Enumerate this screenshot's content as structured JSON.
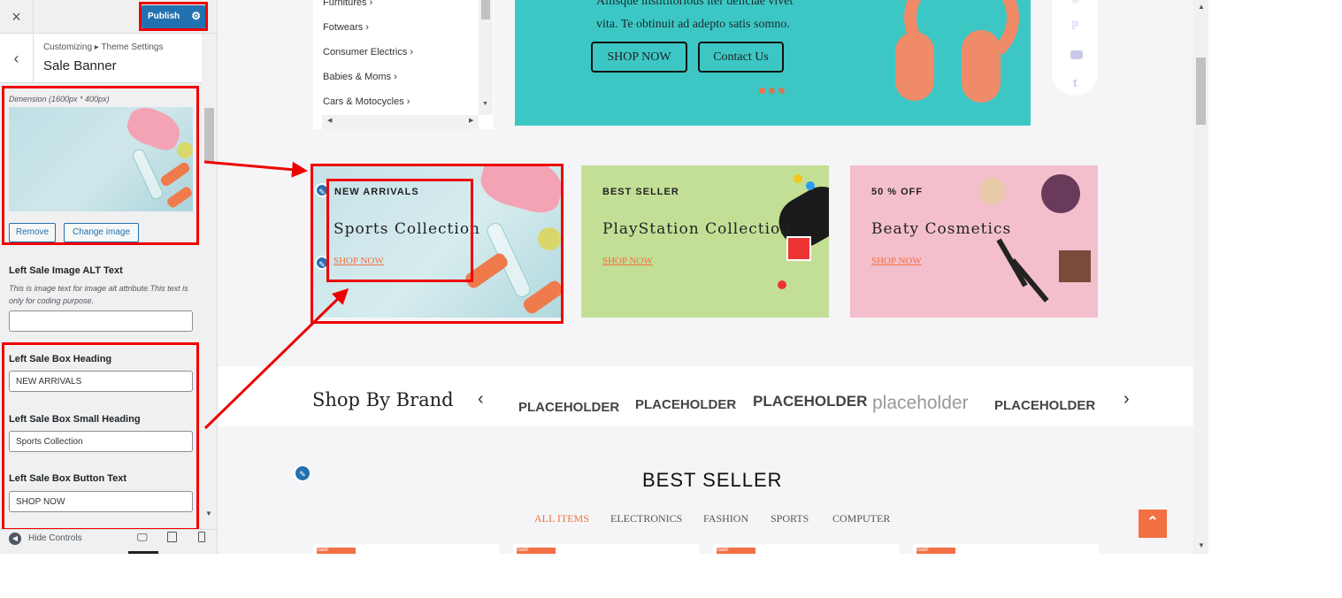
{
  "sidebar": {
    "close_icon": "×",
    "publish_label": "Publish",
    "back_icon": "‹",
    "breadcrumb": "Customizing ▸ Theme Settings",
    "section_title": "Sale Banner",
    "image_dimension": "Dimension (1600px * 400px)",
    "remove_label": "Remove",
    "change_image_label": "Change image",
    "alt_label": "Left Sale Image ALT Text",
    "alt_description": "This is image text for image alt attribute.This text is only for coding purpose.",
    "alt_value": "",
    "heading_label": "Left Sale Box Heading",
    "heading_value": "NEW ARRIVALS",
    "small_heading_label": "Left Sale Box Small Heading",
    "small_heading_value": "Sports Collection",
    "button_text_label": "Left Sale Box Button Text",
    "button_text_value": "SHOP NOW",
    "hide_controls_label": "Hide Controls"
  },
  "preview": {
    "categories": [
      "Furnitures",
      "Fotwears",
      "Consumer Electrics",
      "Babies & Moms",
      "Cars & Motocycles"
    ],
    "hero": {
      "text_line1": "Aliisque instititorious iter deliciae vivet",
      "text_line2": "vita. Te obtinuit ad adepto satis somno.",
      "shop_now": "SHOP NOW",
      "contact_us": "Contact Us"
    },
    "promos": [
      {
        "small": "NEW ARRIVALS",
        "title": "Sports Collection",
        "link": "SHOP NOW"
      },
      {
        "small": "BEST SELLER",
        "title": "PlayStation Collection",
        "link": "SHOP NOW"
      },
      {
        "small": "50 % OFF",
        "title": "Beaty Cosmetics",
        "link": "SHOP NOW"
      }
    ],
    "brand_heading": "Shop By Brand",
    "brands": [
      "PLACEHOLDER",
      "PLACEHOLDER",
      "PLACEHOLDER",
      "placeholder",
      "PLACEHOLDER"
    ],
    "best_seller_title": "BEST SELLER",
    "tabs": [
      "ALL ITEMS",
      "ELECTRONICS",
      "FASHION",
      "SPORTS",
      "COMPUTER"
    ],
    "sale_badge": "Sale!"
  },
  "colors": {
    "accent": "#2271b1",
    "highlight": "#ee0000",
    "orange": "#f37042",
    "hero_bg": "#3cc7c5"
  }
}
